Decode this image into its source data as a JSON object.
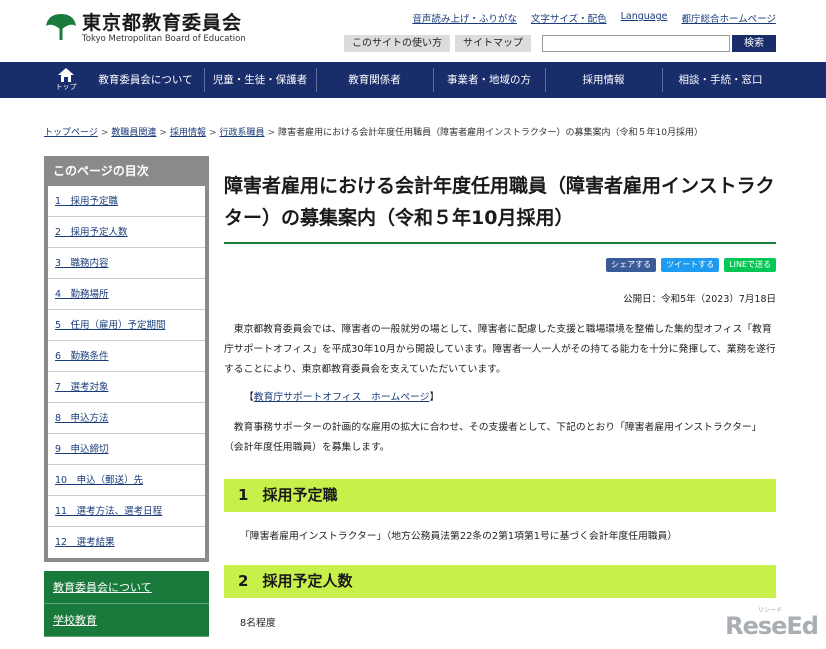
{
  "header": {
    "logo_ja": "東京都教育委員会",
    "logo_en": "Tokyo Metropolitan Board of Education",
    "top_links": [
      "音声読み上げ・ふりがな",
      "文字サイズ・配色",
      "Language",
      "都庁総合ホームページ"
    ],
    "sub_buttons": [
      "このサイトの使い方",
      "サイトマップ"
    ],
    "search_button": "検索",
    "search_value": ""
  },
  "nav": {
    "home_label": "トップ",
    "items": [
      "教育委員会について",
      "児童・生徒・保護者",
      "教育関係者",
      "事業者・地域の方",
      "採用情報",
      "相談・手続・窓口"
    ]
  },
  "breadcrumb": {
    "links": [
      "トップページ",
      "教職員関連",
      "採用情報",
      "行政系職員"
    ],
    "current": "障害者雇用における会計年度任用職員（障害者雇用インストラクター）の募集案内（令和５年10月採用）",
    "separator": ">"
  },
  "toc": {
    "title": "このページの目次",
    "items": [
      "1　採用予定職",
      "2　採用予定人数",
      "3　職務内容",
      "4　勤務場所",
      "5　任用（雇用）予定期間",
      "6　勤務条件",
      "7　選考対象",
      "8　申込方法",
      "9　申込締切",
      "10　申込（郵送）先",
      "11　選考方法、選考日程",
      "12　選考結果"
    ]
  },
  "side_nav": {
    "items": [
      "教育委員会について",
      "学校教育"
    ]
  },
  "main": {
    "title": "障害者雇用における会計年度任用職員（障害者雇用インストラクター）の募集案内（令和５年10月採用）",
    "share": {
      "facebook": "シェアする",
      "twitter": "ツイートする",
      "line": "LINEで送る"
    },
    "pubdate": "公開日：令和5年（2023）7月18日",
    "para1": "東京都教育委員会では、障害者の一般就労の場として、障害者に配慮した支援と職場環境を整備した集約型オフィス「教育庁サポートオフィス」を平成30年10月から開設しています。障害者一人一人がその持てる能力を十分に発揮して、業務を遂行することにより、東京都教育委員会を支えていただいています。",
    "link_open": "【",
    "link_text": "教育庁サポートオフィス　ホームページ",
    "link_close": "】",
    "para2": "教育事務サポーターの計画的な雇用の拡大に合わせ、その支援者として、下記のとおり「障害者雇用インストラクター」（会計年度任用職員）を募集します。",
    "sections": [
      {
        "num": "1",
        "title": "採用予定職",
        "body": "「障害者雇用インストラクター」（地方公務員法第22条の2第1項第1号に基づく会計年度任用職員）"
      },
      {
        "num": "2",
        "title": "採用予定人数",
        "body": "8名程度"
      }
    ]
  },
  "watermark": {
    "text": "ReseEd",
    "small": "リシード"
  },
  "colors": {
    "nav": "#1a2d6b",
    "accent_green": "#1a7a3c",
    "section_bg": "#c8f04a",
    "link": "#1a3c7a"
  }
}
